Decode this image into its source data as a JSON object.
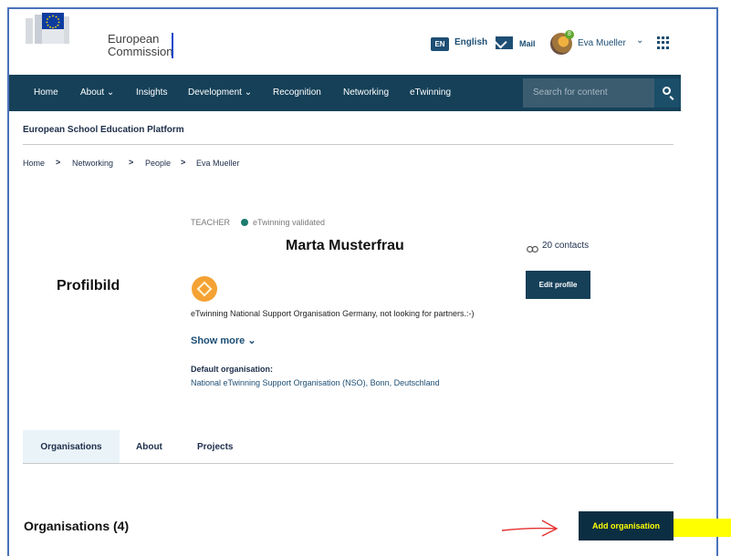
{
  "header": {
    "logo_text_line1": "European",
    "logo_text_line2": "Commission",
    "language_code": "EN",
    "language_label": "English",
    "mail_label": "Mail",
    "user_badge_count": "8",
    "user_name": "Eva Mueller",
    "user_menu_chevron": "⌄"
  },
  "nav": {
    "items": [
      "Home",
      "About ⌄",
      "Insights",
      "Development ⌄",
      "Recognition",
      "Networking",
      "eTwinning"
    ],
    "search_placeholder": "Search for content"
  },
  "platform_title": "European School Education Platform",
  "breadcrumb": [
    "Home",
    "Networking",
    "People",
    "Eva Mueller"
  ],
  "profile": {
    "role": "TEACHER",
    "validation": "eTwinning validated",
    "name": "Marta Musterfrau",
    "contacts": "20 contacts",
    "photo_placeholder": "Profilbild",
    "edit_button": "Edit profile",
    "description": "eTwinning National Support Organisation Germany, not looking for partners.:-)",
    "show_more": "Show more ⌄",
    "default_org_label": "Default organisation:",
    "default_org_value": "National eTwinning Support Organisation (NSO), Bonn, Deutschland"
  },
  "tabs": [
    "Organisations",
    "About",
    "Projects"
  ],
  "organisations": {
    "heading": "Organisations (4)",
    "add_button": "Add organisation"
  },
  "colors": {
    "nav_bg": "#154058",
    "button_bg": "#163f58",
    "highlight": "#ffff00",
    "annotation_arrow": "#e53030"
  }
}
